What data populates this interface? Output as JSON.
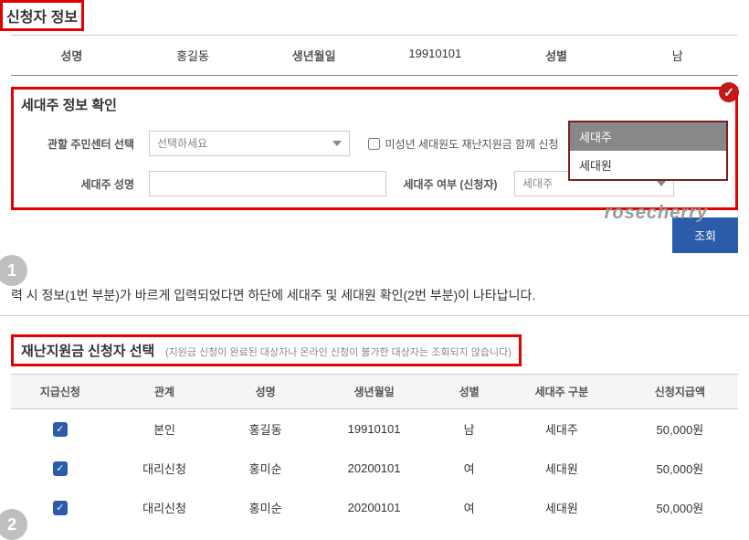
{
  "applicant": {
    "title": "신청자 정보",
    "name_label": "성명",
    "name": "홍길동",
    "dob_label": "생년월일",
    "dob": "19910101",
    "gender_label": "성별",
    "gender": "남"
  },
  "householder": {
    "title": "세대주 정보 확인",
    "center_label": "관할 주민센터 선택",
    "center_placeholder": "선택하세요",
    "minor_checkbox": "미성년 세대원도 재난지원금 함께 신청",
    "name_label": "세대주 성명",
    "type_label": "세대주 여부 (신청자)",
    "type_placeholder": "세대주",
    "dropdown_options": [
      "세대주",
      "세대원"
    ],
    "watermark": "rosecherry",
    "submit": "조회"
  },
  "step1": "1",
  "step2": "2",
  "description": "력 시 정보(1번 부분)가 바르게 입력되었다면 하단에 세대주 및 세대원 확인(2번 부분)이 나타납니다.",
  "selection": {
    "title": "재난지원금 신청자 선택",
    "note": "(지원금 신청이 완료된 대상자나 온라인 신청이 불가한 대상자는 조회되지 않습니다)",
    "headers": [
      "지급신청",
      "관계",
      "성명",
      "생년월일",
      "성별",
      "세대주 구분",
      "신청지급액"
    ],
    "rows": [
      {
        "checked": true,
        "relation": "본인",
        "name": "홍길동",
        "dob": "19910101",
        "gender": "남",
        "type": "세대주",
        "amount": "50,000원"
      },
      {
        "checked": true,
        "relation": "대리신청",
        "name": "홍미순",
        "dob": "20200101",
        "gender": "여",
        "type": "세대원",
        "amount": "50,000원"
      },
      {
        "checked": true,
        "relation": "대리신청",
        "name": "홍미순",
        "dob": "20200101",
        "gender": "여",
        "type": "세대원",
        "amount": "50,000원"
      }
    ]
  }
}
